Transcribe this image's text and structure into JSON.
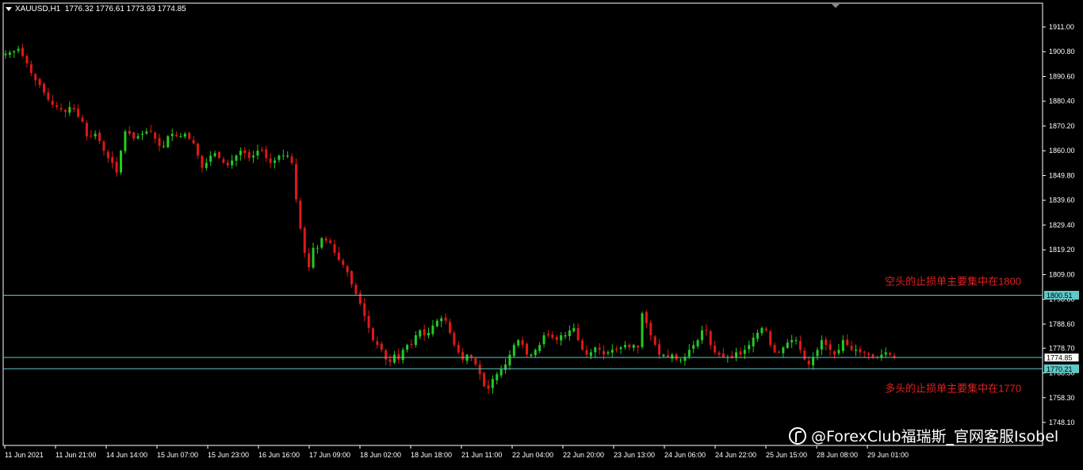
{
  "header": {
    "symbol": "XAUUSD,H1",
    "ohlc": "1776.32 1776.61 1773.93 1774.85",
    "menu_icon": "triangle-down-icon"
  },
  "watermark": {
    "text": "@ForexClub福瑞斯_官网客服Isobel",
    "icon": "forexclub-logo-icon"
  },
  "colors": {
    "background": "#000000",
    "frame": "#ffffff",
    "bull": "#22cc22",
    "bear": "#e01818",
    "hline": "#5fc9c9",
    "annotation": "#e02020",
    "price_label_bg": "#5fc9c9"
  },
  "chart_data": {
    "type": "candlestick",
    "instrument": "XAUUSD",
    "timeframe": "H1",
    "ylim": [
      1748.1,
      1917.0
    ],
    "y_ticks": [
      "1911.00",
      "1900.80",
      "1890.60",
      "1880.40",
      "1870.20",
      "1860.00",
      "1849.80",
      "1839.60",
      "1829.40",
      "1819.20",
      "1809.00",
      "1798.80",
      "1788.60",
      "1778.70",
      "1768.50",
      "1758.30",
      "1748.10"
    ],
    "x_ticks": [
      "11 Jun 2021",
      "11 Jun 21:00",
      "14 Jun 14:00",
      "15 Jun 07:00",
      "15 Jun 23:00",
      "16 Jun 16:00",
      "17 Jun 09:00",
      "18 Jun 02:00",
      "18 Jun 18:00",
      "21 Jun 11:00",
      "22 Jun 04:00",
      "22 Jun 20:00",
      "23 Jun 13:00",
      "24 Jun 06:00",
      "24 Jun 22:00",
      "25 Jun 15:00",
      "28 Jun 08:00",
      "29 Jun 01:00"
    ],
    "trend_closes": [
      1900,
      1900.5,
      1901,
      1902,
      1899,
      1896,
      1892,
      1889,
      1887,
      1884,
      1881,
      1879,
      1878,
      1877,
      1876,
      1878,
      1877,
      1874,
      1872,
      1866,
      1866,
      1867,
      1864,
      1860,
      1857,
      1855,
      1851,
      1860,
      1868,
      1867,
      1865,
      1866,
      1867,
      1868,
      1868,
      1865,
      1862,
      1862,
      1866,
      1867,
      1866,
      1866,
      1867,
      1865,
      1863,
      1858,
      1853,
      1855,
      1858,
      1859,
      1857,
      1855,
      1854,
      1856,
      1858,
      1860,
      1859,
      1857,
      1858,
      1860,
      1860,
      1857,
      1855,
      1856,
      1858,
      1858,
      1858,
      1855,
      1840,
      1828,
      1818,
      1812,
      1820,
      1820,
      1824,
      1823,
      1822,
      1818,
      1815,
      1813,
      1810,
      1805,
      1801,
      1797,
      1792,
      1787,
      1782,
      1780,
      1778,
      1774,
      1773,
      1776,
      1774,
      1778,
      1780,
      1780,
      1784,
      1786,
      1784,
      1785,
      1788,
      1790,
      1791,
      1790,
      1785,
      1780,
      1777,
      1774,
      1776,
      1775,
      1772,
      1768,
      1763,
      1762,
      1766,
      1768,
      1770,
      1772,
      1776,
      1780,
      1782,
      1780,
      1776,
      1776,
      1778,
      1780,
      1784,
      1784,
      1783,
      1782,
      1784,
      1784,
      1786,
      1787,
      1782,
      1778,
      1776,
      1777,
      1779,
      1778,
      1776,
      1777,
      1778,
      1778,
      1779,
      1780,
      1779,
      1780,
      1779,
      1793,
      1789,
      1784,
      1780,
      1776,
      1776,
      1775,
      1776,
      1774,
      1774,
      1775,
      1778,
      1780,
      1782,
      1786,
      1786,
      1780,
      1777,
      1776,
      1775,
      1775,
      1775,
      1777,
      1776,
      1778,
      1780,
      1783,
      1785,
      1787,
      1786,
      1780,
      1777,
      1777,
      1779,
      1781,
      1782,
      1782,
      1778,
      1774,
      1772,
      1775,
      1778,
      1782,
      1780,
      1778,
      1776,
      1778,
      1782,
      1780,
      1778,
      1778,
      1777,
      1777,
      1776,
      1775,
      1775,
      1776,
      1777,
      1776,
      1775
    ],
    "horizontal_lines": [
      {
        "price": "1800.51",
        "label": "1800.51",
        "label_style": "filled"
      },
      {
        "price": "1774.85",
        "label": "1774.85",
        "label_style": "boxed"
      },
      {
        "price": "1770.21",
        "label": "1770.21",
        "label_style": "filled"
      }
    ],
    "annotations": [
      {
        "text": "空头的止损单主要集中在1800",
        "near_price": 1806,
        "position": "right"
      },
      {
        "text": "多头的止损单主要集中在1770",
        "near_price": 1762,
        "position": "right"
      }
    ],
    "grid": false,
    "legend": "none"
  }
}
